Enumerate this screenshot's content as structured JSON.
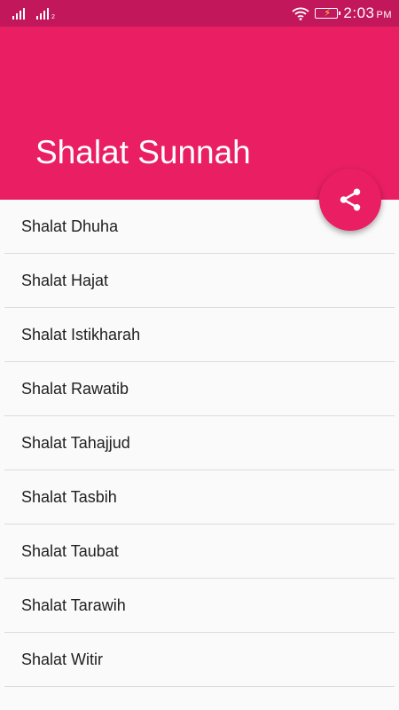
{
  "status_bar": {
    "sim1_icon": "signal-bars-icon",
    "sim2_icon": "signal-bars-icon",
    "sim2_label": "2",
    "wifi_icon": "wifi-icon",
    "battery_icon": "battery-charging-icon",
    "time": "2:03",
    "ampm": "PM"
  },
  "app_bar": {
    "title": "Shalat Sunnah",
    "color": "#e91e63"
  },
  "fab": {
    "icon": "share-icon",
    "color": "#e91e63"
  },
  "list": {
    "items": [
      {
        "label": "Shalat Dhuha"
      },
      {
        "label": "Shalat Hajat"
      },
      {
        "label": "Shalat Istikharah"
      },
      {
        "label": "Shalat Rawatib"
      },
      {
        "label": "Shalat Tahajjud"
      },
      {
        "label": "Shalat Tasbih"
      },
      {
        "label": "Shalat Taubat"
      },
      {
        "label": "Shalat Tarawih"
      },
      {
        "label": "Shalat Witir"
      }
    ]
  }
}
